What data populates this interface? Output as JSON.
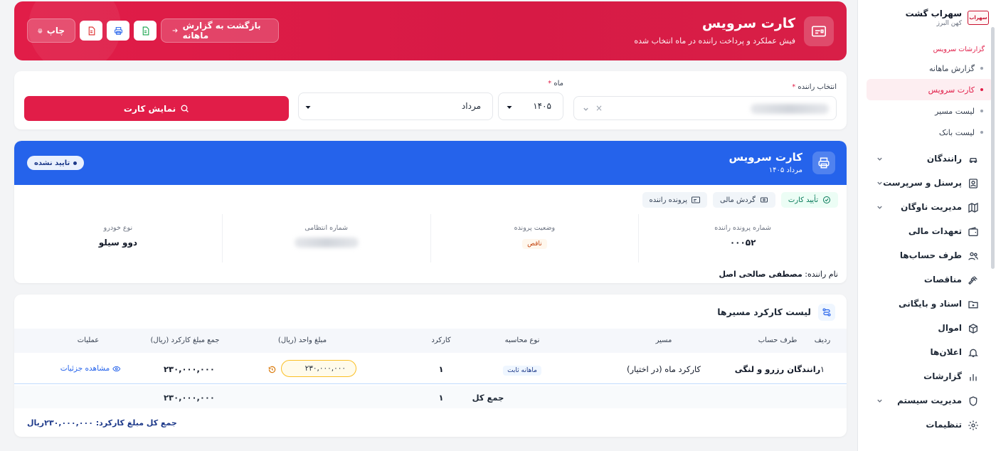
{
  "sidebar": {
    "brand_name": "سهراب گشت",
    "brand_sub": "کهن البرز",
    "brand_logo": "سهراب",
    "group_title": "گزارشات سرویس",
    "sub_items": [
      {
        "label": "گزارش ماهانه",
        "active": false
      },
      {
        "label": "کارت سرویس",
        "active": true
      },
      {
        "label": "لیست مسیر",
        "active": false
      },
      {
        "label": "لیست بانک",
        "active": false
      }
    ],
    "nav_items": [
      {
        "label": "رانندگان",
        "icon": "car-icon",
        "chevron": true
      },
      {
        "label": "پرسنل و سرپرست",
        "icon": "id-card-icon",
        "chevron": true
      },
      {
        "label": "مدیریت ناوگان",
        "icon": "map-icon",
        "chevron": true
      },
      {
        "label": "تعهدات مالی",
        "icon": "wallet-icon",
        "chevron": false
      },
      {
        "label": "طرف حساب‌ها",
        "icon": "users-icon",
        "chevron": false
      },
      {
        "label": "مناقصات",
        "icon": "gavel-icon",
        "chevron": false
      },
      {
        "label": "اسناد و بایگانی",
        "icon": "folder-icon",
        "chevron": false
      },
      {
        "label": "اموال",
        "icon": "box-icon",
        "chevron": false
      },
      {
        "label": "اعلان‌ها",
        "icon": "bell-icon",
        "chevron": false
      },
      {
        "label": "گزارشات",
        "icon": "chart-icon",
        "chevron": false
      },
      {
        "label": "مدیریت سیستم",
        "icon": "shield-icon",
        "chevron": true
      },
      {
        "label": "تنظیمات",
        "icon": "gear-icon",
        "chevron": false
      }
    ]
  },
  "hero": {
    "title": "کارت سرویس",
    "subtitle": "فیش عملکرد و پرداخت راننده در ماه انتخاب شده",
    "back_label": "بازگشت به گزارش ماهانه",
    "print_label": "چاپ"
  },
  "filter": {
    "driver_label": "انتخاب راننده",
    "month_label": "ماه",
    "year_value": "۱۴۰۵",
    "month_value": "مرداد",
    "submit_label": "نمایش کارت"
  },
  "service": {
    "title": "کارت سرویس",
    "period": "مرداد ۱۴۰۵",
    "status": "تایید نشده",
    "tags": [
      "تأیید کارت",
      "گردش مالی",
      "پرونده راننده"
    ],
    "fields": [
      {
        "label": "شماره پرونده راننده",
        "value": "۰۰۰۵۲"
      },
      {
        "label": "وضعیت پرونده",
        "value": "ناقص"
      },
      {
        "label": "شماره انتظامی",
        "value": ""
      },
      {
        "label": "نوع خودرو",
        "value": "دوو سیلو"
      }
    ],
    "driver_name_label": "نام راننده:",
    "driver_name": "مصطفی صالحی اصل"
  },
  "routes": {
    "title": "لیست کارکرد مسیرها",
    "columns": [
      "ردیف",
      "طرف حساب",
      "مسیر",
      "نوع محاسبه",
      "کارکرد",
      "مبلغ واحد (ریال)",
      "جمع مبلغ کارکرد (ریال)",
      "عملیات"
    ],
    "rows": [
      {
        "index": "۱",
        "account": "رانندگان رزرو و لنگی",
        "route": "کارکرد ماه (در اختیار)",
        "calc_type": "ماهانه ثابت",
        "work": "۱",
        "unit_price": "۲۳۰,۰۰۰,۰۰۰",
        "total": "۲۳۰,۰۰۰,۰۰۰",
        "action": "مشاهده جزئیات"
      }
    ],
    "footer": {
      "label": "جمع کل",
      "work": "۱",
      "total": "۲۳۰,۰۰۰,۰۰۰"
    },
    "grand_total_label": "جمع کل مبلغ کارکرد:",
    "grand_total_value": "۲۳۰,۰۰۰,۰۰۰ریال"
  }
}
